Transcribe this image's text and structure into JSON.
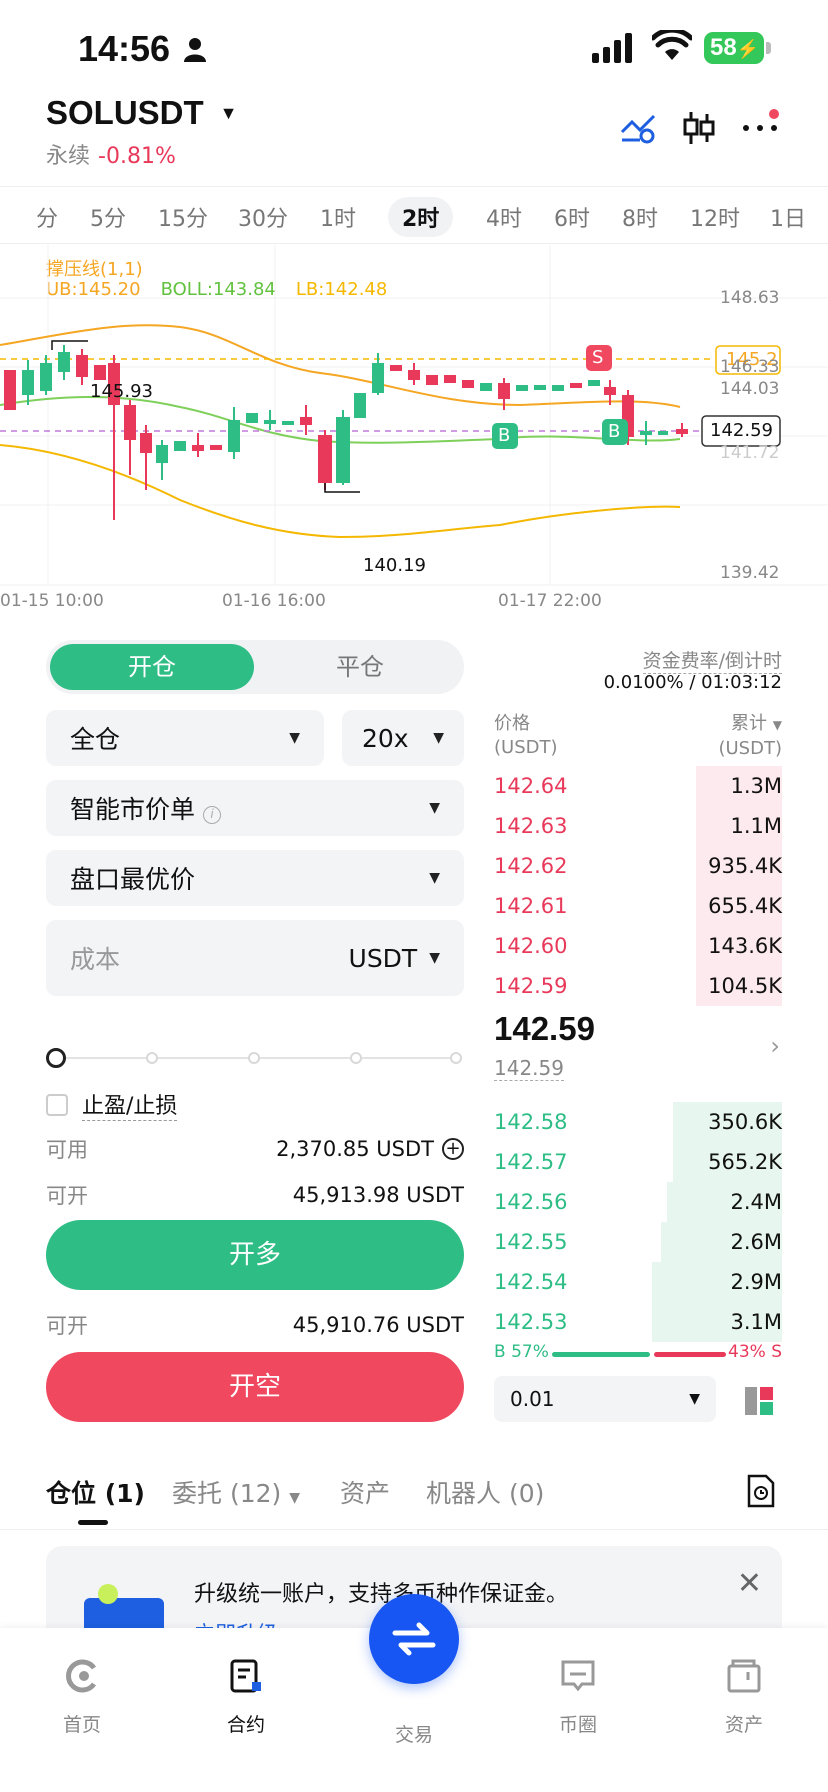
{
  "status_bar": {
    "time": "14:56",
    "battery": "58"
  },
  "header": {
    "pair": "SOLUSDT",
    "type": "永续",
    "change": "-0.81%"
  },
  "timeframes": [
    "分",
    "5分",
    "15分",
    "30分",
    "1时",
    "2时",
    "4时",
    "6时",
    "8时",
    "12时",
    "1日"
  ],
  "active_timeframe": "2时",
  "chart": {
    "indicator_name": "撑压线(1,1)",
    "ub": "UB:145.20",
    "boll": "BOLL:143.84",
    "lb": "LB:142.48",
    "price_axis": [
      "148.63",
      "146.33",
      "144.03",
      "141.72",
      "139.42"
    ],
    "time_axis": [
      "01-15 10:00",
      "01-16 16:00",
      "01-17 22:00"
    ],
    "high_label": "145.93",
    "low_label": "140.19",
    "ub_tag": "145.2",
    "last_tag": "142.59",
    "markers": {
      "sell": "S",
      "buy": "B"
    },
    "colors": {
      "up": "#2ebd85",
      "down": "#e8395a",
      "ub": "#f5a623",
      "boll": "#7ed05a",
      "lb": "#f5b800"
    }
  },
  "form": {
    "open_tab": "开仓",
    "close_tab": "平仓",
    "margin_mode": "全仓",
    "leverage": "20x",
    "order_type": "智能市价单",
    "price_type": "盘口最优价",
    "cost_placeholder": "成本",
    "cost_unit": "USDT",
    "slider_percent": 0,
    "tp_sl": "止盈/止损",
    "available_label": "可用",
    "available_value": "2,370.85 USDT",
    "max_open_label": "可开",
    "max_long_value": "45,913.98 USDT",
    "long_button": "开多",
    "max_short_value": "45,910.76 USDT",
    "short_button": "开空"
  },
  "orderbook": {
    "funding_label": "资金费率/倒计时",
    "funding_value": "0.0100% / 01:03:12",
    "price_header": "价格",
    "price_unit": "(USDT)",
    "amount_header": "累计",
    "amount_unit": "(USDT)",
    "asks": [
      {
        "price": "142.64",
        "amount": "1.3M",
        "depth": 0.3
      },
      {
        "price": "142.63",
        "amount": "1.1M",
        "depth": 0.3
      },
      {
        "price": "142.62",
        "amount": "935.4K",
        "depth": 0.3
      },
      {
        "price": "142.61",
        "amount": "655.4K",
        "depth": 0.3
      },
      {
        "price": "142.60",
        "amount": "143.6K",
        "depth": 0.3
      },
      {
        "price": "142.59",
        "amount": "104.5K",
        "depth": 0.3
      }
    ],
    "last_price": "142.59",
    "mark_price": "142.59",
    "bids": [
      {
        "price": "142.58",
        "amount": "350.6K",
        "depth": 0.38
      },
      {
        "price": "142.57",
        "amount": "565.2K",
        "depth": 0.38
      },
      {
        "price": "142.56",
        "amount": "2.4M",
        "depth": 0.4
      },
      {
        "price": "142.55",
        "amount": "2.6M",
        "depth": 0.42
      },
      {
        "price": "142.54",
        "amount": "2.9M",
        "depth": 0.45
      },
      {
        "price": "142.53",
        "amount": "3.1M",
        "depth": 0.45
      }
    ],
    "buy_ratio": "B 57%",
    "sell_ratio": "43% S",
    "precision": "0.01"
  },
  "positions_tabs": [
    {
      "label": "仓位 (1)"
    },
    {
      "label": "委托 (12)"
    },
    {
      "label": "资产"
    },
    {
      "label": "机器人 (0)"
    }
  ],
  "banner": {
    "text": "升级统一账户，支持多币种作保证金。",
    "link": "立即升级"
  },
  "bottom_nav": [
    {
      "label": "首页",
      "icon": "home-icon"
    },
    {
      "label": "合约",
      "icon": "futures-icon"
    },
    {
      "label": "交易",
      "icon": "trade-icon"
    },
    {
      "label": "币圈",
      "icon": "community-icon"
    },
    {
      "label": "资产",
      "icon": "wallet-icon"
    }
  ]
}
